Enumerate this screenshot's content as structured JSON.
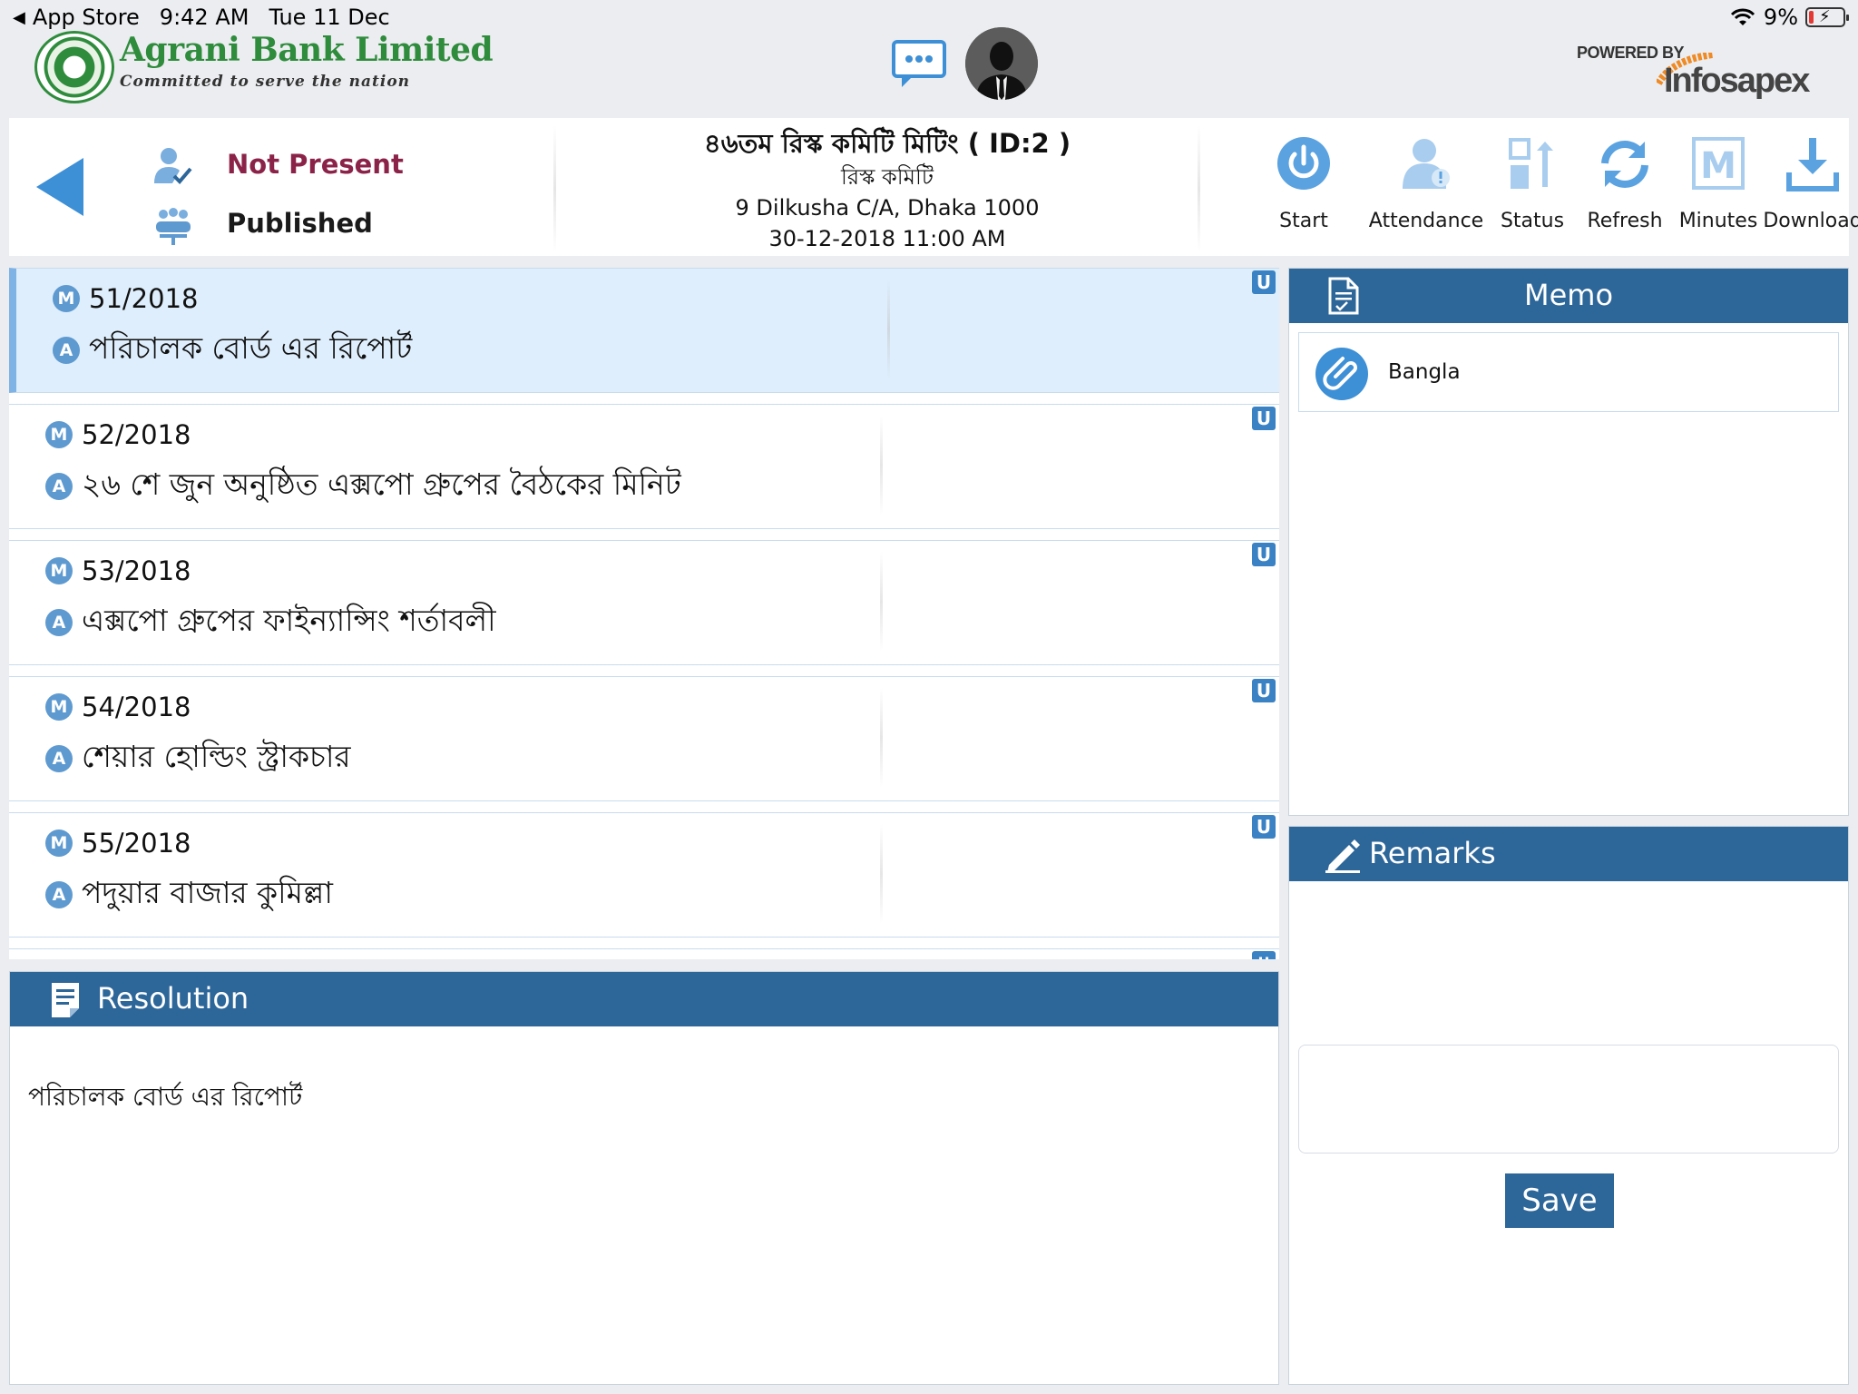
{
  "status_bar": {
    "back_app": "App Store",
    "time": "9:42 AM",
    "date": "Tue 11 Dec",
    "battery": "9%"
  },
  "brand": {
    "bank_name": "Agrani Bank Limited",
    "tagline": "Committed to serve the nation",
    "powered_by": "POWERED BY",
    "vendor": "Infosapex"
  },
  "header": {
    "attendance_status": "Not Present",
    "publish_status": "Published",
    "meeting_title": "৪৬তম রিস্ক কমিটি মিটিং ( ID:2 )",
    "committee": "রিস্ক কমিটি",
    "address": "9 Dilkusha C/A, Dhaka 1000",
    "datetime": "30-12-2018 11:00 AM"
  },
  "toolbar": {
    "start": "Start",
    "attendance": "Attendance",
    "status": "Status",
    "refresh": "Refresh",
    "minutes": "Minutes",
    "download": "Download"
  },
  "agenda": {
    "badge_m": "M",
    "badge_a": "A",
    "badge_u": "U",
    "items": [
      {
        "memo_no": "51/2018",
        "title": "পরিচালক বোর্ড এর রিপোর্ট",
        "selected": true
      },
      {
        "memo_no": "52/2018",
        "title": "২৬ শে জুন অনুষ্ঠিত এক্সপো গ্রুপের বৈঠকের মিনিট",
        "selected": false
      },
      {
        "memo_no": "53/2018",
        "title": "এক্সপো গ্রুপের ফাইন্যান্সিং শর্তাবলী",
        "selected": false
      },
      {
        "memo_no": "54/2018",
        "title": "শেয়ার হোল্ডিং স্ট্রাকচার",
        "selected": false
      },
      {
        "memo_no": "55/2018",
        "title": "পদুয়ার বাজার কুমিল্লা",
        "selected": false
      }
    ]
  },
  "resolution": {
    "heading": "Resolution",
    "text": "পরিচালক বোর্ড এর রিপোর্ট"
  },
  "memo": {
    "heading": "Memo",
    "attachments": [
      {
        "label": "Bangla"
      }
    ]
  },
  "remarks": {
    "heading": "Remarks",
    "value": "",
    "save_label": "Save"
  },
  "colors": {
    "panel_header": "#2d6699",
    "accent_blue": "#3d8fd6",
    "selected_row": "#deeefc",
    "not_present": "#8b2349",
    "brand_green": "#2f8c3c"
  },
  "icons": {
    "back": "back-arrow-icon",
    "chat": "chat-bubble-icon",
    "avatar": "user-avatar-icon",
    "attendance_status": "user-check-icon",
    "publish_status": "meeting-group-icon",
    "start": "power-icon",
    "attendance": "user-alert-icon",
    "status": "status-arrow-icon",
    "refresh": "refresh-icon",
    "minutes": "minutes-m-icon",
    "download": "download-icon",
    "memo": "document-icon",
    "resolution": "note-icon",
    "remarks": "pencil-icon",
    "attachment": "paperclip-icon"
  }
}
